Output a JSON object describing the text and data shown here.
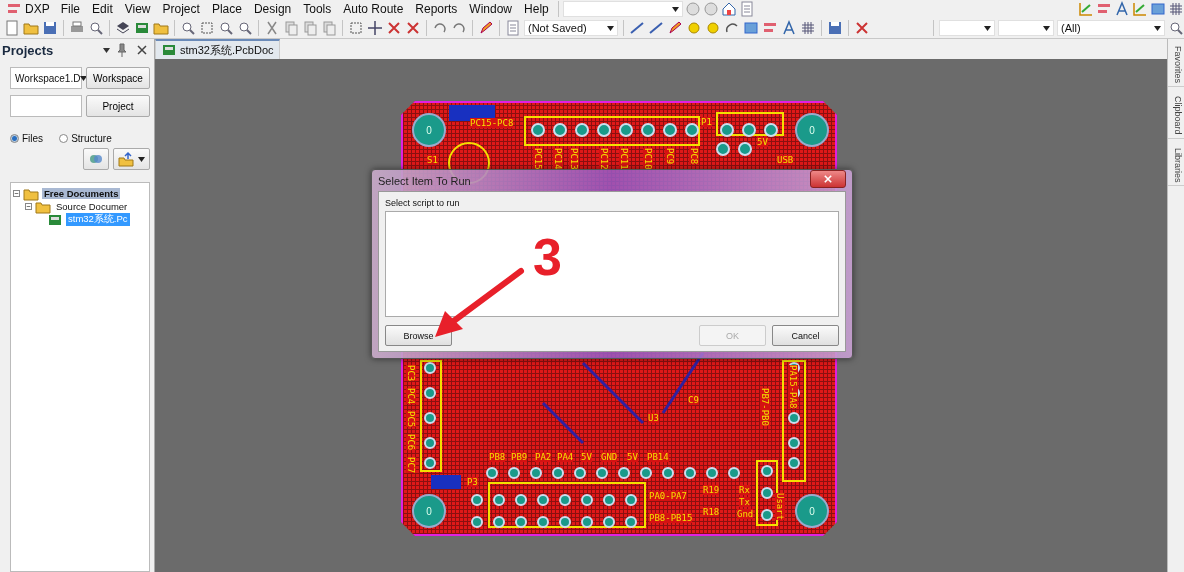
{
  "menu": {
    "app": "DXP",
    "items": [
      "File",
      "Edit",
      "View",
      "Project",
      "Place",
      "Design",
      "Tools",
      "Auto Route",
      "Reports",
      "Window",
      "Help"
    ]
  },
  "toolbar": {
    "document_combo": "(Not Saved)",
    "filter_combo": "(All)"
  },
  "projects_panel": {
    "title": "Projects",
    "workspace_combo": "Workspace1.D",
    "workspace_button": "Workspace",
    "project_button": "Project",
    "view_options": [
      {
        "label": "Files",
        "selected": true
      },
      {
        "label": "Structure",
        "selected": false
      }
    ],
    "tree": [
      {
        "label": "Free Documents",
        "expanded": true,
        "highlighted": true,
        "selected": false,
        "children": [
          {
            "label": "Source Documer",
            "expanded": true,
            "highlighted": false,
            "selected": false,
            "children": [
              {
                "label": "stm32系统.Pc",
                "highlighted": false,
                "selected": true
              }
            ]
          }
        ]
      }
    ]
  },
  "document_tabs": [
    {
      "label": "stm32系统.PcbDoc",
      "selected": true
    }
  ],
  "pcb": {
    "hole_labels": [
      "0",
      "0",
      "0",
      "0"
    ],
    "labels": [
      "PC15-PC8",
      "P1",
      "5V",
      "USB",
      "S1",
      "PC15",
      "PC14",
      "PC13",
      "PC12",
      "PC11",
      "PC10",
      "PC9",
      "PC8",
      "PC3",
      "PC4",
      "PC5",
      "PC6",
      "PC7",
      "U3",
      "C9",
      "PB8",
      "PB9",
      "PA2",
      "PA4",
      "5V",
      "GND",
      "5V",
      "PB14",
      "P3",
      "PA0-PA7",
      "PB8-PB15",
      "R19",
      "R18",
      "Rx",
      "Tx",
      "Gnd",
      "Usart",
      "PB7-PB0",
      "PA15-PA8"
    ]
  },
  "dialog": {
    "title": "Select Item To Run",
    "prompt": "Select script to run",
    "buttons": [
      {
        "label": "Browse",
        "disabled": false
      },
      {
        "label": "OK",
        "disabled": true
      },
      {
        "label": "Cancel",
        "disabled": false
      }
    ]
  },
  "annotation": {
    "step": "3"
  },
  "side_tabs": [
    "Favorites",
    "Clipboard",
    "Libraries"
  ]
}
